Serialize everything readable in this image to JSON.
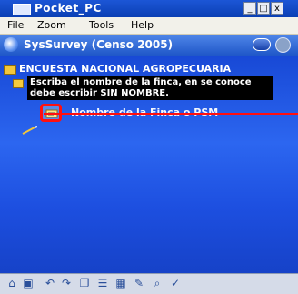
{
  "window": {
    "title": "Pocket_PC",
    "min_label": "_",
    "max_label": "□",
    "close_label": "x"
  },
  "menu": {
    "items": [
      "File",
      "Zoom",
      "Tools",
      "Help"
    ]
  },
  "app": {
    "title": "SysSurvey (Censo 2005)"
  },
  "tree": {
    "survey_title": "ENCUESTA NACIONAL AGROPECUARIA",
    "tooltip": "Escriba el nombre de la finca, en se conoce debe escribir SIN NOMBRE.",
    "field_label": "Nombre de la Finca o PSM"
  },
  "colors": {
    "highlight": "#ff1010",
    "content_bg": "#2c66f0"
  },
  "toolbar": {
    "icons": [
      "home-icon",
      "save-icon",
      "undo-icon",
      "redo-icon",
      "copy-icon",
      "format-icon",
      "table-icon",
      "edit-icon",
      "search-icon",
      "check-icon"
    ]
  }
}
